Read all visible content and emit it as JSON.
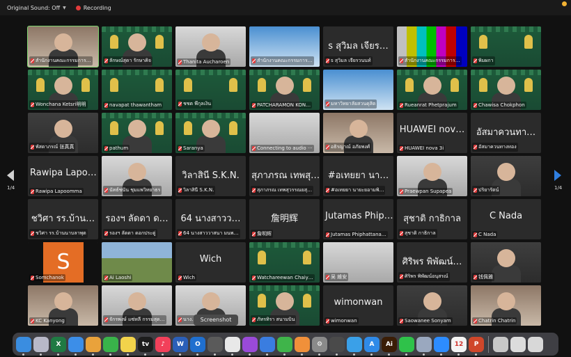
{
  "topbar": {
    "original_sound": "Original Sound: Off",
    "recording": "Recording"
  },
  "pagination": {
    "left": "1/4",
    "right": "1/4"
  },
  "tooltip": "Screenshot",
  "tiles": [
    {
      "label": "สำนักงานคณะกรรมการ…",
      "big": "",
      "bg": "photo",
      "person": true,
      "active": true
    },
    {
      "label": "ลักษณ์สุดา รักษาคิจ",
      "big": "",
      "bg": "green",
      "person": true
    },
    {
      "label": "Thanita Aucharoen",
      "big": "",
      "bg": "light",
      "person": true
    },
    {
      "label": "สำนักงานคณะกรรมการ…",
      "big": "",
      "bg": "blue",
      "person": false
    },
    {
      "label": "s สุวิมล เจียรวนนท์",
      "big": "s สุวิมล เจียร…",
      "bg": "",
      "person": false
    },
    {
      "label": "สำนักงานคณะกรรมการ…",
      "big": "",
      "bg": "bars",
      "person": false
    },
    {
      "label": "พิมผกา",
      "big": "",
      "bg": "green",
      "person": false
    },
    {
      "label": "Wonchana Ketsri明明",
      "big": "",
      "bg": "green",
      "person": true
    },
    {
      "label": "navapat thawantham",
      "big": "",
      "bg": "green",
      "person": false
    },
    {
      "label": "ชชต พึกุลเงิน",
      "big": "",
      "bg": "green",
      "person": false
    },
    {
      "label": "PATCHARAMON KON…",
      "big": "",
      "bg": "green",
      "person": true
    },
    {
      "label": "มหาวิทยาลัยสวนดุสิต",
      "big": "",
      "bg": "blue",
      "person": false
    },
    {
      "label": "Rueanrat Phetprajum",
      "big": "",
      "bg": "green",
      "person": true
    },
    {
      "label": "Chawisa Chokphon",
      "big": "",
      "bg": "green",
      "person": true
    },
    {
      "label": "พัสดาภรณ์ 张真真",
      "big": "",
      "bg": "dim",
      "person": true
    },
    {
      "label": "pathum",
      "big": "",
      "bg": "green",
      "person": true
    },
    {
      "label": "Saranya",
      "big": "",
      "bg": "green",
      "person": true
    },
    {
      "label": "Connecting to audio ···",
      "big": "",
      "bg": "light",
      "person": false
    },
    {
      "label": "อธิรญาณ์ อภัยพงศ์",
      "big": "",
      "bg": "photo",
      "person": true
    },
    {
      "label": "HUAWEI nova 3i",
      "big": "HUAWEI nov…",
      "bg": "",
      "person": false
    },
    {
      "label": "อัสมาควนทางทอง",
      "big": "อัสมาควนทา…",
      "bg": "",
      "person": false
    },
    {
      "label": "Rawipa Lapoomma",
      "big": "Rawipa Lapo…",
      "bg": "",
      "person": false
    },
    {
      "label": "นัทธ์ชนัน ชุมแพวิทยาธร",
      "big": "",
      "bg": "light",
      "person": true
    },
    {
      "label": "วิลาสินี S.K.N.",
      "big": "วิลาสินี S.K.N.",
      "bg": "",
      "person": false
    },
    {
      "label": "สุภาภรณ เทพสุวรรณยสุ…",
      "big": "สุภาภรณ เทพสุ…",
      "bg": "",
      "person": false
    },
    {
      "label": "#อเทยยา นายะยอามพิ…",
      "big": "#อเทยยา นา…",
      "bg": "",
      "person": false
    },
    {
      "label": "Praewpan Supapea",
      "big": "",
      "bg": "light",
      "person": true
    },
    {
      "label": "ปริยารัตน์",
      "big": "",
      "bg": "dim",
      "person": true
    },
    {
      "label": "ชวิศา รร.บ้านนาบลาพุต",
      "big": "ชวิศา รร.บ้าน…",
      "bg": "",
      "person": false
    },
    {
      "label": "รองฯ ลัดดา ดอกประดู่",
      "big": "รองฯ ลัดดา ด…",
      "bg": "",
      "person": false
    },
    {
      "label": "64 นางสาววาสนา มนพ…",
      "big": "64 นางสาวว…",
      "bg": "",
      "person": false
    },
    {
      "label": "詹明辉",
      "big": "詹明辉",
      "bg": "",
      "person": false
    },
    {
      "label": "Jutamas Phiphattana…",
      "big": "Jutamas Phip…",
      "bg": "",
      "person": false
    },
    {
      "label": "สุชาติ กาธิกาล",
      "big": "สุชาติ กาธิกาล",
      "bg": "",
      "person": false
    },
    {
      "label": "C Nada",
      "big": "C   Nada",
      "bg": "",
      "person": false
    },
    {
      "label": "Somchanok",
      "big": "",
      "bg": "orange",
      "person": false,
      "letter": "S"
    },
    {
      "label": "Ai Laoshi",
      "big": "",
      "bg": "mountain",
      "person": false
    },
    {
      "label": "Wich",
      "big": "Wich",
      "bg": "",
      "person": false
    },
    {
      "label": "Watchareewan Chaiy…",
      "big": "",
      "bg": "green",
      "person": false
    },
    {
      "label": "吴 維安",
      "big": "",
      "bg": "light",
      "person": false
    },
    {
      "label": "ศิริพร พิพัฒน์อนุสรณ์",
      "big": "ศิริพร พิพัฒน์…",
      "bg": "",
      "person": false
    },
    {
      "label": "钱佩雅",
      "big": "",
      "bg": "dim",
      "person": true
    },
    {
      "label": "KC Kanyong",
      "big": "",
      "bg": "photo",
      "person": true
    },
    {
      "label": "จักรพงษ์ แซ่หลี กรรมสุด…",
      "big": "",
      "bg": "light",
      "person": true
    },
    {
      "label": "นาง…",
      "big": "",
      "bg": "light",
      "person": true
    },
    {
      "label": "ภัทรทิรา สนามบิน",
      "big": "",
      "bg": "green",
      "person": true
    },
    {
      "label": "wimonwan",
      "big": "wimonwan",
      "bg": "",
      "person": false
    },
    {
      "label": "Saowanee Sonyam",
      "big": "",
      "bg": "dim",
      "person": true
    },
    {
      "label": "Chatrin Chatrin",
      "big": "",
      "bg": "photo",
      "person": true
    }
  ],
  "dock": [
    {
      "name": "finder-icon",
      "color": "#3a8de0",
      "glyph": ""
    },
    {
      "name": "launchpad-icon",
      "color": "#b8b8c8",
      "glyph": ""
    },
    {
      "name": "excel-icon",
      "color": "#1f7a43",
      "glyph": "X"
    },
    {
      "name": "mail-icon",
      "color": "#3c8ee8",
      "glyph": ""
    },
    {
      "name": "photos-icon",
      "color": "#e9a23b",
      "glyph": ""
    },
    {
      "name": "facetime-icon",
      "color": "#39b34a",
      "glyph": ""
    },
    {
      "name": "notes-icon",
      "color": "#f2d34b",
      "glyph": ""
    },
    {
      "name": "appletv-icon",
      "color": "#1d1d1d",
      "glyph": "tv"
    },
    {
      "name": "music-icon",
      "color": "#f2405a",
      "glyph": "♪"
    },
    {
      "name": "word-icon",
      "color": "#2b5fb8",
      "glyph": "W"
    },
    {
      "name": "outlook-icon",
      "color": "#1f6fcf",
      "glyph": "O"
    },
    {
      "name": "screenshot-icon",
      "color": "#5a5a5a",
      "glyph": ""
    },
    {
      "name": "chrome-icon",
      "color": "#e8e8e8",
      "glyph": ""
    },
    {
      "name": "podcasts-icon",
      "color": "#9a4ad8",
      "glyph": ""
    },
    {
      "name": "keynote-icon",
      "color": "#3a7de0",
      "glyph": ""
    },
    {
      "name": "numbers-icon",
      "color": "#3fb44a",
      "glyph": ""
    },
    {
      "name": "pages-icon",
      "color": "#f0903a",
      "glyph": ""
    },
    {
      "name": "settings-icon",
      "color": "#8a8a8a",
      "glyph": "⚙"
    },
    {
      "name": "calculator-icon",
      "color": "#4a4a4a",
      "glyph": ""
    },
    {
      "name": "safari-icon",
      "color": "#3aa0e8",
      "glyph": ""
    },
    {
      "name": "appstore-icon",
      "color": "#2f8ae8",
      "glyph": "A"
    },
    {
      "name": "illustrator-icon",
      "color": "#3a1d06",
      "glyph": "Ai"
    },
    {
      "name": "line-icon",
      "color": "#2fc24a",
      "glyph": ""
    },
    {
      "name": "preview-icon",
      "color": "#9aa8bf",
      "glyph": ""
    },
    {
      "name": "zoom-icon",
      "color": "#2d8cff",
      "glyph": ""
    },
    {
      "name": "calendar-icon",
      "color": "#f4f4f4",
      "glyph": "12"
    },
    {
      "name": "powerpoint-icon",
      "color": "#d0472a",
      "glyph": "P"
    },
    {
      "name": "window-icon",
      "color": "#c8c8c8",
      "glyph": ""
    },
    {
      "name": "document-icon",
      "color": "#dcdcdc",
      "glyph": ""
    },
    {
      "name": "trash-icon",
      "color": "#d8d8d8",
      "glyph": ""
    }
  ]
}
